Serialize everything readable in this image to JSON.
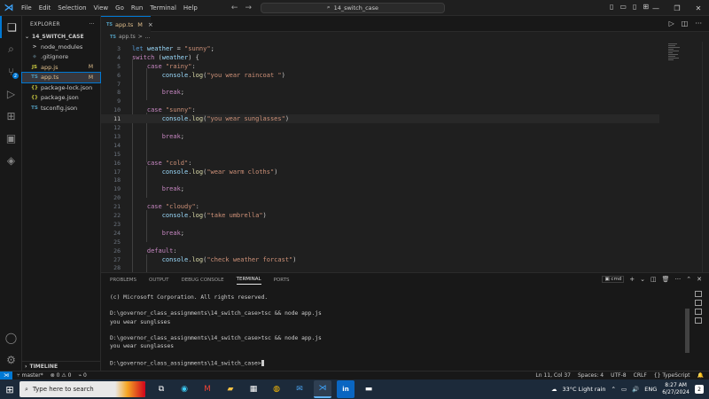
{
  "titlebar": {
    "menu": [
      "File",
      "Edit",
      "Selection",
      "View",
      "Go",
      "Run",
      "Terminal",
      "Help"
    ],
    "search_text": "14_switch_case"
  },
  "activity_badge": "2",
  "sidebar": {
    "title": "EXPLORER",
    "folder": "14_SWITCH_CASE",
    "files": [
      {
        "icon": ">",
        "name": "node_modules",
        "status": "",
        "modified": false,
        "selected": false,
        "indent": 1
      },
      {
        "icon": "◆",
        "name": ".gitignore",
        "status": "",
        "modified": false,
        "selected": false,
        "indent": 1
      },
      {
        "icon": "JS",
        "name": "app.js",
        "status": "M",
        "modified": true,
        "selected": false,
        "indent": 1
      },
      {
        "icon": "TS",
        "name": "app.ts",
        "status": "M",
        "modified": true,
        "selected": true,
        "indent": 1
      },
      {
        "icon": "{}",
        "name": "package-lock.json",
        "status": "",
        "modified": false,
        "selected": false,
        "indent": 1
      },
      {
        "icon": "{}",
        "name": "package.json",
        "status": "",
        "modified": false,
        "selected": false,
        "indent": 1
      },
      {
        "icon": "TS",
        "name": "tsconfig.json",
        "status": "",
        "modified": false,
        "selected": false,
        "indent": 1
      }
    ],
    "timeline": "TIMELINE"
  },
  "tab": {
    "lang": "TS",
    "name": "app.ts",
    "modified": "M",
    "close": "×"
  },
  "breadcrumb": {
    "lang": "TS",
    "file": "app.ts",
    "sep": ">",
    "more": "..."
  },
  "code": {
    "current_line": "11",
    "lines": [
      {
        "n": "3",
        "text": "let weather = \"sunny\";"
      },
      {
        "n": "4",
        "text": "switch (weather) {"
      },
      {
        "n": "5",
        "text": "    case \"rainy\":"
      },
      {
        "n": "6",
        "text": "        console.log(\"you wear raincoat \")"
      },
      {
        "n": "7",
        "text": ""
      },
      {
        "n": "8",
        "text": "        break;"
      },
      {
        "n": "9",
        "text": ""
      },
      {
        "n": "10",
        "text": "    case \"sunny\":"
      },
      {
        "n": "11",
        "text": "        console.log(\"you wear sunglasses\")"
      },
      {
        "n": "12",
        "text": ""
      },
      {
        "n": "13",
        "text": "        break;"
      },
      {
        "n": "14",
        "text": ""
      },
      {
        "n": "15",
        "text": ""
      },
      {
        "n": "16",
        "text": "    case \"cold\":"
      },
      {
        "n": "17",
        "text": "        console.log(\"wear warm cloths\")"
      },
      {
        "n": "18",
        "text": ""
      },
      {
        "n": "19",
        "text": "        break;"
      },
      {
        "n": "20",
        "text": ""
      },
      {
        "n": "21",
        "text": "    case \"cloudy\":"
      },
      {
        "n": "22",
        "text": "        console.log(\"take umbrella\")"
      },
      {
        "n": "23",
        "text": ""
      },
      {
        "n": "24",
        "text": "        break;"
      },
      {
        "n": "25",
        "text": ""
      },
      {
        "n": "26",
        "text": "    default:"
      },
      {
        "n": "27",
        "text": "        console.log(\"check weather forcast\")"
      },
      {
        "n": "28",
        "text": ""
      }
    ]
  },
  "panel": {
    "tabs": [
      "PROBLEMS",
      "OUTPUT",
      "DEBUG CONSOLE",
      "TERMINAL",
      "PORTS"
    ],
    "active_tab": "TERMINAL",
    "shell": "cmd",
    "terminal_lines": [
      "(c) Microsoft Corporation. All rights reserved.",
      "",
      "D:\\governor_class_assignments\\14_switch_case>tsc && node app.js",
      "you wear sunglsses",
      "",
      "D:\\governor_class_assignments\\14_switch_case>tsc && node app.js",
      "you wear sunglasses",
      "",
      "D:\\governor_class_assignments\\14_switch_case>"
    ]
  },
  "statusbar": {
    "branch": "master*",
    "errors": "⊗ 0",
    "warnings": "⚠ 0",
    "ports": "0",
    "position": "Ln 11, Col 37",
    "spaces": "Spaces: 4",
    "encoding": "UTF-8",
    "eol": "CRLF",
    "language": "{} TypeScript"
  },
  "taskbar": {
    "search_placeholder": "Type here to search",
    "weather": "33°C  Light rain",
    "lang": "ENG",
    "time": "8:27 AM",
    "date": "6/27/2024",
    "notifications": "2"
  }
}
